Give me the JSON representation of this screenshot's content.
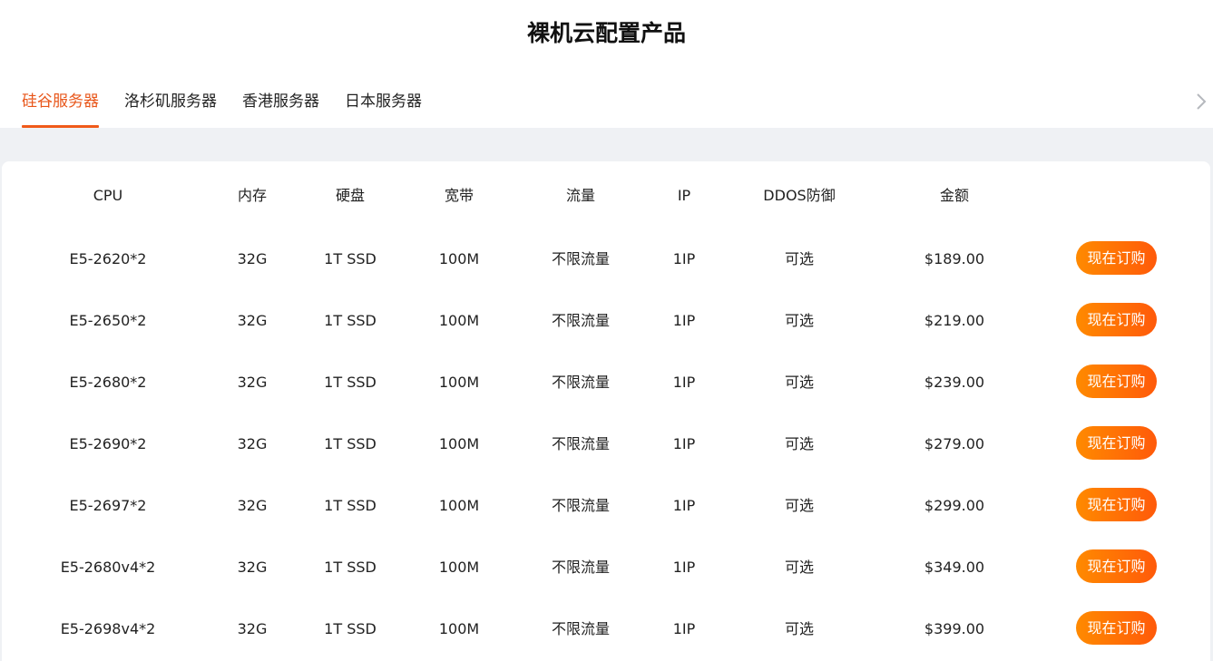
{
  "page_title": "裸机云配置产品",
  "tabs": [
    {
      "label": "硅谷服务器",
      "active": true
    },
    {
      "label": "洛杉矶服务器",
      "active": false
    },
    {
      "label": "香港服务器",
      "active": false
    },
    {
      "label": "日本服务器",
      "active": false
    }
  ],
  "table": {
    "headers": {
      "cpu": "CPU",
      "memory": "内存",
      "disk": "硬盘",
      "bandwidth": "宽带",
      "traffic": "流量",
      "ip": "IP",
      "ddos": "DDOS防御",
      "price": "金额"
    },
    "order_label": "现在订购",
    "rows": [
      {
        "cpu": "E5-2620*2",
        "memory": "32G",
        "disk": "1T SSD",
        "bandwidth": "100M",
        "traffic": "不限流量",
        "ip": "1IP",
        "ddos": "可选",
        "price": "$189.00"
      },
      {
        "cpu": "E5-2650*2",
        "memory": "32G",
        "disk": "1T SSD",
        "bandwidth": "100M",
        "traffic": "不限流量",
        "ip": "1IP",
        "ddos": "可选",
        "price": "$219.00"
      },
      {
        "cpu": "E5-2680*2",
        "memory": "32G",
        "disk": "1T SSD",
        "bandwidth": "100M",
        "traffic": "不限流量",
        "ip": "1IP",
        "ddos": "可选",
        "price": "$239.00"
      },
      {
        "cpu": "E5-2690*2",
        "memory": "32G",
        "disk": "1T SSD",
        "bandwidth": "100M",
        "traffic": "不限流量",
        "ip": "1IP",
        "ddos": "可选",
        "price": "$279.00"
      },
      {
        "cpu": "E5-2697*2",
        "memory": "32G",
        "disk": "1T SSD",
        "bandwidth": "100M",
        "traffic": "不限流量",
        "ip": "1IP",
        "ddos": "可选",
        "price": "$299.00"
      },
      {
        "cpu": "E5-2680v4*2",
        "memory": "32G",
        "disk": "1T SSD",
        "bandwidth": "100M",
        "traffic": "不限流量",
        "ip": "1IP",
        "ddos": "可选",
        "price": "$349.00"
      },
      {
        "cpu": "E5-2698v4*2",
        "memory": "32G",
        "disk": "1T SSD",
        "bandwidth": "100M",
        "traffic": "不限流量",
        "ip": "1IP",
        "ddos": "可选",
        "price": "$399.00"
      }
    ]
  },
  "icons": {
    "scroll_right": "chevron-right-icon"
  },
  "colors": {
    "accent": "#f05a1a",
    "button_gradient_start": "#ff8a00",
    "button_gradient_end": "#ff5a0a",
    "background_gray": "#eff1f4"
  }
}
